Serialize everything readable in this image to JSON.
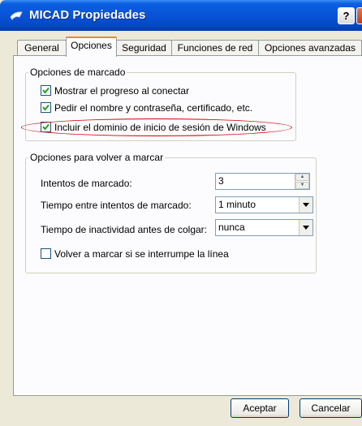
{
  "window": {
    "title": "MICAD Propiedades",
    "help_label": "?",
    "close_label": "×"
  },
  "tabs": [
    {
      "label": "General"
    },
    {
      "label": "Opciones"
    },
    {
      "label": "Seguridad"
    },
    {
      "label": "Funciones de red"
    },
    {
      "label": "Opciones avanzadas"
    }
  ],
  "active_tab": "Opciones",
  "dialing_options": {
    "legend": "Opciones de marcado",
    "items": [
      {
        "label": "Mostrar el progreso al conectar",
        "checked": true
      },
      {
        "label": "Pedir el nombre y contraseña, certificado, etc.",
        "checked": true
      },
      {
        "label": "Incluir el dominio de inicio de sesión de Windows",
        "checked": true
      }
    ]
  },
  "redial_options": {
    "legend": "Opciones para volver a marcar",
    "attempts": {
      "label": "Intentos de marcado:",
      "value": "3"
    },
    "interval": {
      "label": "Tiempo entre intentos de marcado:",
      "value": "1 minuto"
    },
    "idle": {
      "label": "Tiempo de inactividad antes de colgar:",
      "value": "nunca"
    },
    "redial_on_drop": {
      "label": "Volver a marcar si se interrumpe la línea",
      "checked": false
    }
  },
  "buttons": {
    "ok": "Aceptar",
    "cancel": "Cancelar"
  },
  "colors": {
    "title_bar": "#0853d6",
    "active_tab_accent": "#e68b2c",
    "highlight_ellipse": "#d60000",
    "dialog_bg": "#ece9d8"
  }
}
